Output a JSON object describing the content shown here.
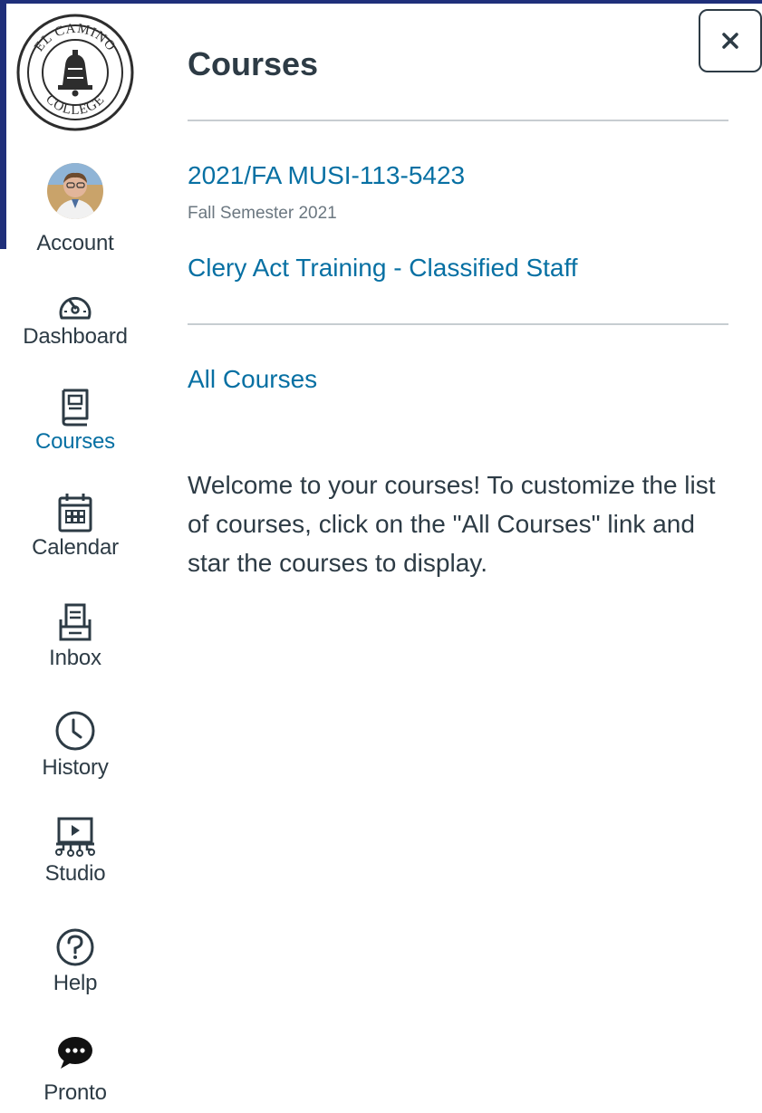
{
  "logo": {
    "name": "el-camino-college-seal",
    "text_top": "EL CAMINO",
    "text_bottom": "COLLEGE"
  },
  "close_button": {
    "label": "×",
    "icon": "close-icon"
  },
  "global_nav": {
    "active_color": "#0770a3",
    "items": [
      {
        "id": "account",
        "label": "Account",
        "icon": "avatar"
      },
      {
        "id": "dashboard",
        "label": "Dashboard",
        "icon": "dashboard-icon"
      },
      {
        "id": "courses",
        "label": "Courses",
        "icon": "book-icon",
        "active": true
      },
      {
        "id": "calendar",
        "label": "Calendar",
        "icon": "calendar-icon"
      },
      {
        "id": "inbox",
        "label": "Inbox",
        "icon": "inbox-icon"
      },
      {
        "id": "history",
        "label": "History",
        "icon": "clock-icon"
      },
      {
        "id": "studio",
        "label": "Studio",
        "icon": "studio-icon"
      },
      {
        "id": "help",
        "label": "Help",
        "icon": "help-icon"
      },
      {
        "id": "pronto",
        "label": "Pronto",
        "icon": "chat-bubble-icon"
      }
    ]
  },
  "tray": {
    "title": "Courses",
    "courses": [
      {
        "name": "2021/FA MUSI-113-5423",
        "term": "Fall Semester 2021"
      },
      {
        "name": "Clery Act Training - Classified Staff",
        "term": ""
      }
    ],
    "all_courses_link": "All Courses",
    "welcome_text": "Welcome to your courses! To customize the list of courses, click on the \"All Courses\" link and star the courses to display."
  }
}
